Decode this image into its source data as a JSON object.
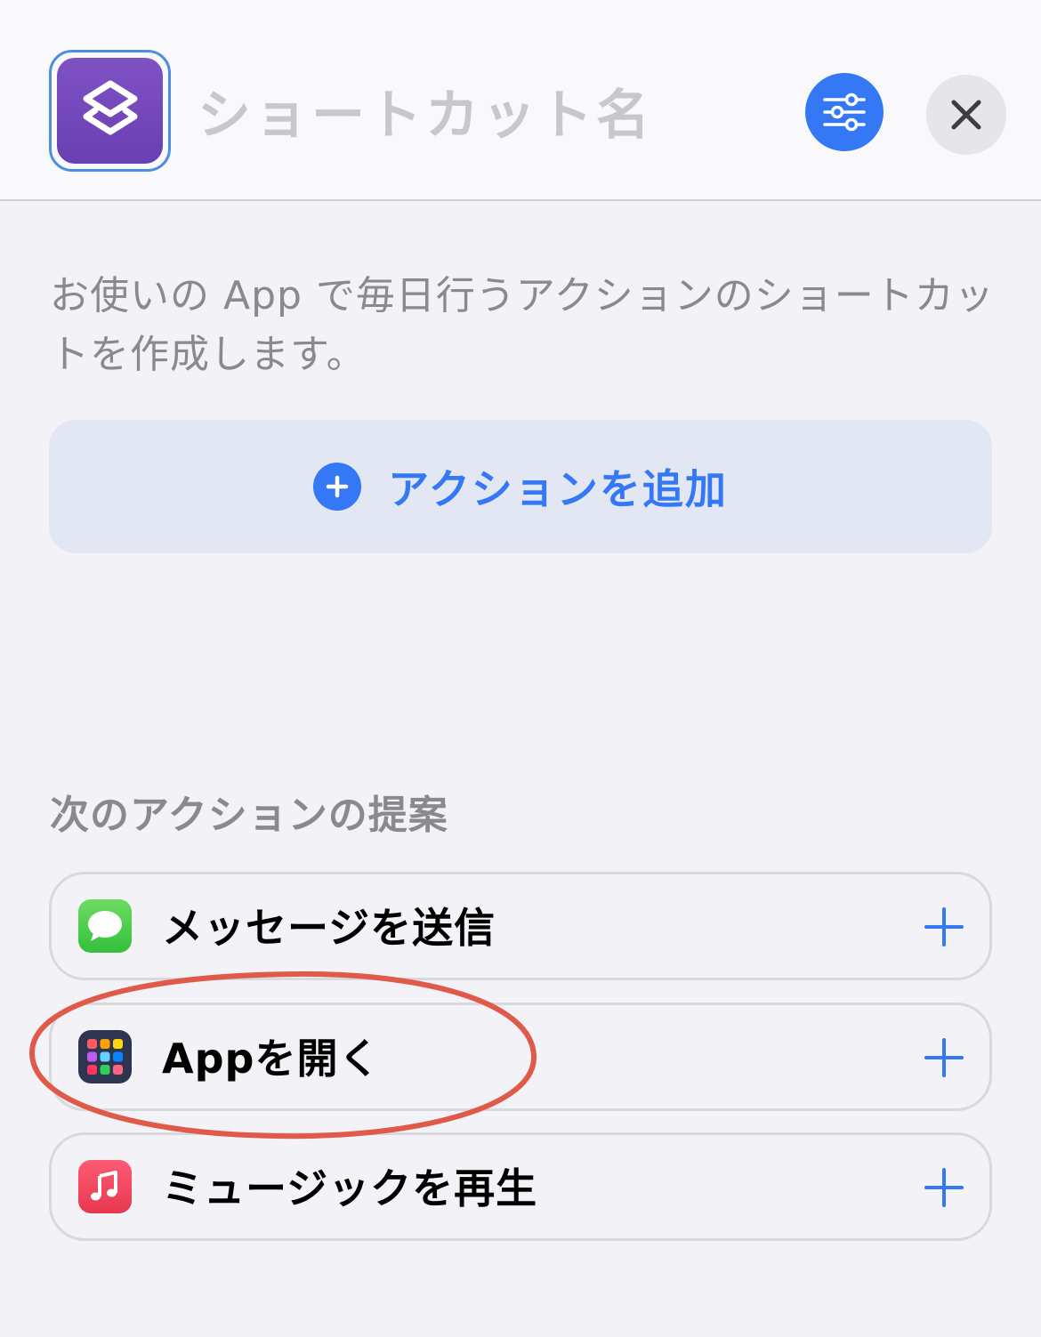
{
  "header": {
    "shortcut_name_placeholder": "ショートカット名",
    "app_icon": "shortcuts-icon",
    "settings_icon": "sliders-icon",
    "close_icon": "close-icon"
  },
  "description": "お使いの App で毎日行うアクションのショートカットを作成します。",
  "add_action": {
    "label": "アクションを追加",
    "icon": "plus-circle-icon"
  },
  "suggestions": {
    "title": "次のアクションの提案",
    "items": [
      {
        "label": "メッセージを送信",
        "icon": "messages-icon"
      },
      {
        "label": "Appを開く",
        "icon": "app-grid-icon"
      },
      {
        "label": "ミュージックを再生",
        "icon": "music-icon"
      }
    ]
  },
  "colors": {
    "accent": "#3478f6",
    "annotation": "#e05a4a",
    "shortcut_icon": "#7248b8"
  }
}
